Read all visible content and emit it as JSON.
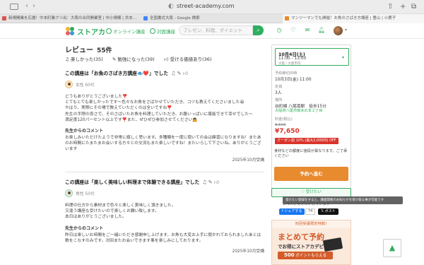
{
  "browser": {
    "url": "street-academy.com",
    "tabs": [
      {
        "label": "新規開業を応援！中本町業クリ出：大阪の合同開業室 | 中小規模 | 共本…",
        "favicon_color": "#d9534f"
      },
      {
        "label": "全国書式大阪 - Google 検索",
        "favicon_color": "#4285f4"
      },
      {
        "label": "マンツーマンでも開催！お魚のさばき方講座 | 豊山 | 小鹿子",
        "favicon_color": "#e88a2e"
      }
    ]
  },
  "site": {
    "logo_text": "ストアカ",
    "nav_online": "オンライン講座",
    "nav_offline": "対面講座",
    "search_placeholder": "プレゼン、料理、ダイエット"
  },
  "reviews": {
    "title": "レビュー",
    "count": "55件",
    "filters": [
      "楽しかった(35)",
      "勉強になった(39)",
      "受ける価値あり(36)"
    ],
    "items": [
      {
        "title": "この講座は「お魚のさばき方講座🐟❤️」でした",
        "user": "女性 60代",
        "body": [
          "どうもありがとうございました❣️",
          "とてもとても楽しかったです〜色々なお魚をさばかせていただき、コツも教えてくださいました😆",
          "やはり、実際にその場で教えていただくのは全いですね❣️",
          "先生の手際の良さで、そのさばいたお魚を料理していただき、お腹いっぱいに堪能できて幸せでした〜",
          "満足度120パーセント以上です❣️また、ぜひぜひ参加させてください🙇"
        ],
        "reply_heading": "先生からのコメント",
        "reply": [
          "お楽しみいただけたようで非常に嬉しく思います。多種類を一度に捌いての会は練習になりますね！またあのお時間にたまたまお会いする方々との交流もまた楽しいですね！またいらして下さいね。ありがとうございます"
        ],
        "date": "2025年10月受講"
      },
      {
        "title": "この講座は「楽しく美味しい料理まで体験できる講座」でした",
        "user": "男性 50代",
        "body": [
          "料理の仕方から素材まで色々と楽しく美味しく頂きました。",
          "又違う講座も受けたいので楽しくお願い致します。",
          "本日はありがとうございました。"
        ],
        "reply_heading": "先生からのコメント",
        "reply": [
          "昨日は楽しいお時間をご一緒いただき感謝申し上げます。お魚も大変お上手に捌かれておられましたあとは数をこなすのみです。次回またお会いできます事を楽しみにしております。"
        ],
        "date": "2025年10月受講"
      }
    ]
  },
  "booking": {
    "date": "10月4日(土)",
    "time": "11:00 - 13:00",
    "venue_short": "大阪 / 大阪市内",
    "deadline_label": "予約締切日時",
    "deadline": "10月3日(金) 11:00",
    "capacity_label": "定員",
    "capacity": "3人",
    "place_label": "場所",
    "place": "谷町線 八尾南駅　徒歩15分",
    "address": "大阪府八尾市南木の本２丁目",
    "fee_label": "料金(税込)",
    "old_price": "8,500",
    "price": "¥7,650",
    "coupon": "クーポン割 10% (最大2,000円) OFF",
    "note": "食材などの都度に値段が異なります。ご了承ください",
    "reserve_label": "予約へ進む",
    "fav_label": "受けたい",
    "fav_count": "179人が受けたいしています",
    "tooltip": "受けたい登録をすると、講座開催のお知らせを受け取る事が可能です",
    "share_fb": "シェアする",
    "share_fb_count": "74",
    "share_x": "ポスト"
  },
  "banner": {
    "top": "初回受講限定特典！",
    "big": "まとめて予約",
    "sub": "でお得にストアカデビュー",
    "points": "500",
    "points_suffix": "ポイントもらえる"
  },
  "colors": {
    "brand": "#2fae5f",
    "accent": "#e88a2e",
    "price": "#d9342b"
  }
}
